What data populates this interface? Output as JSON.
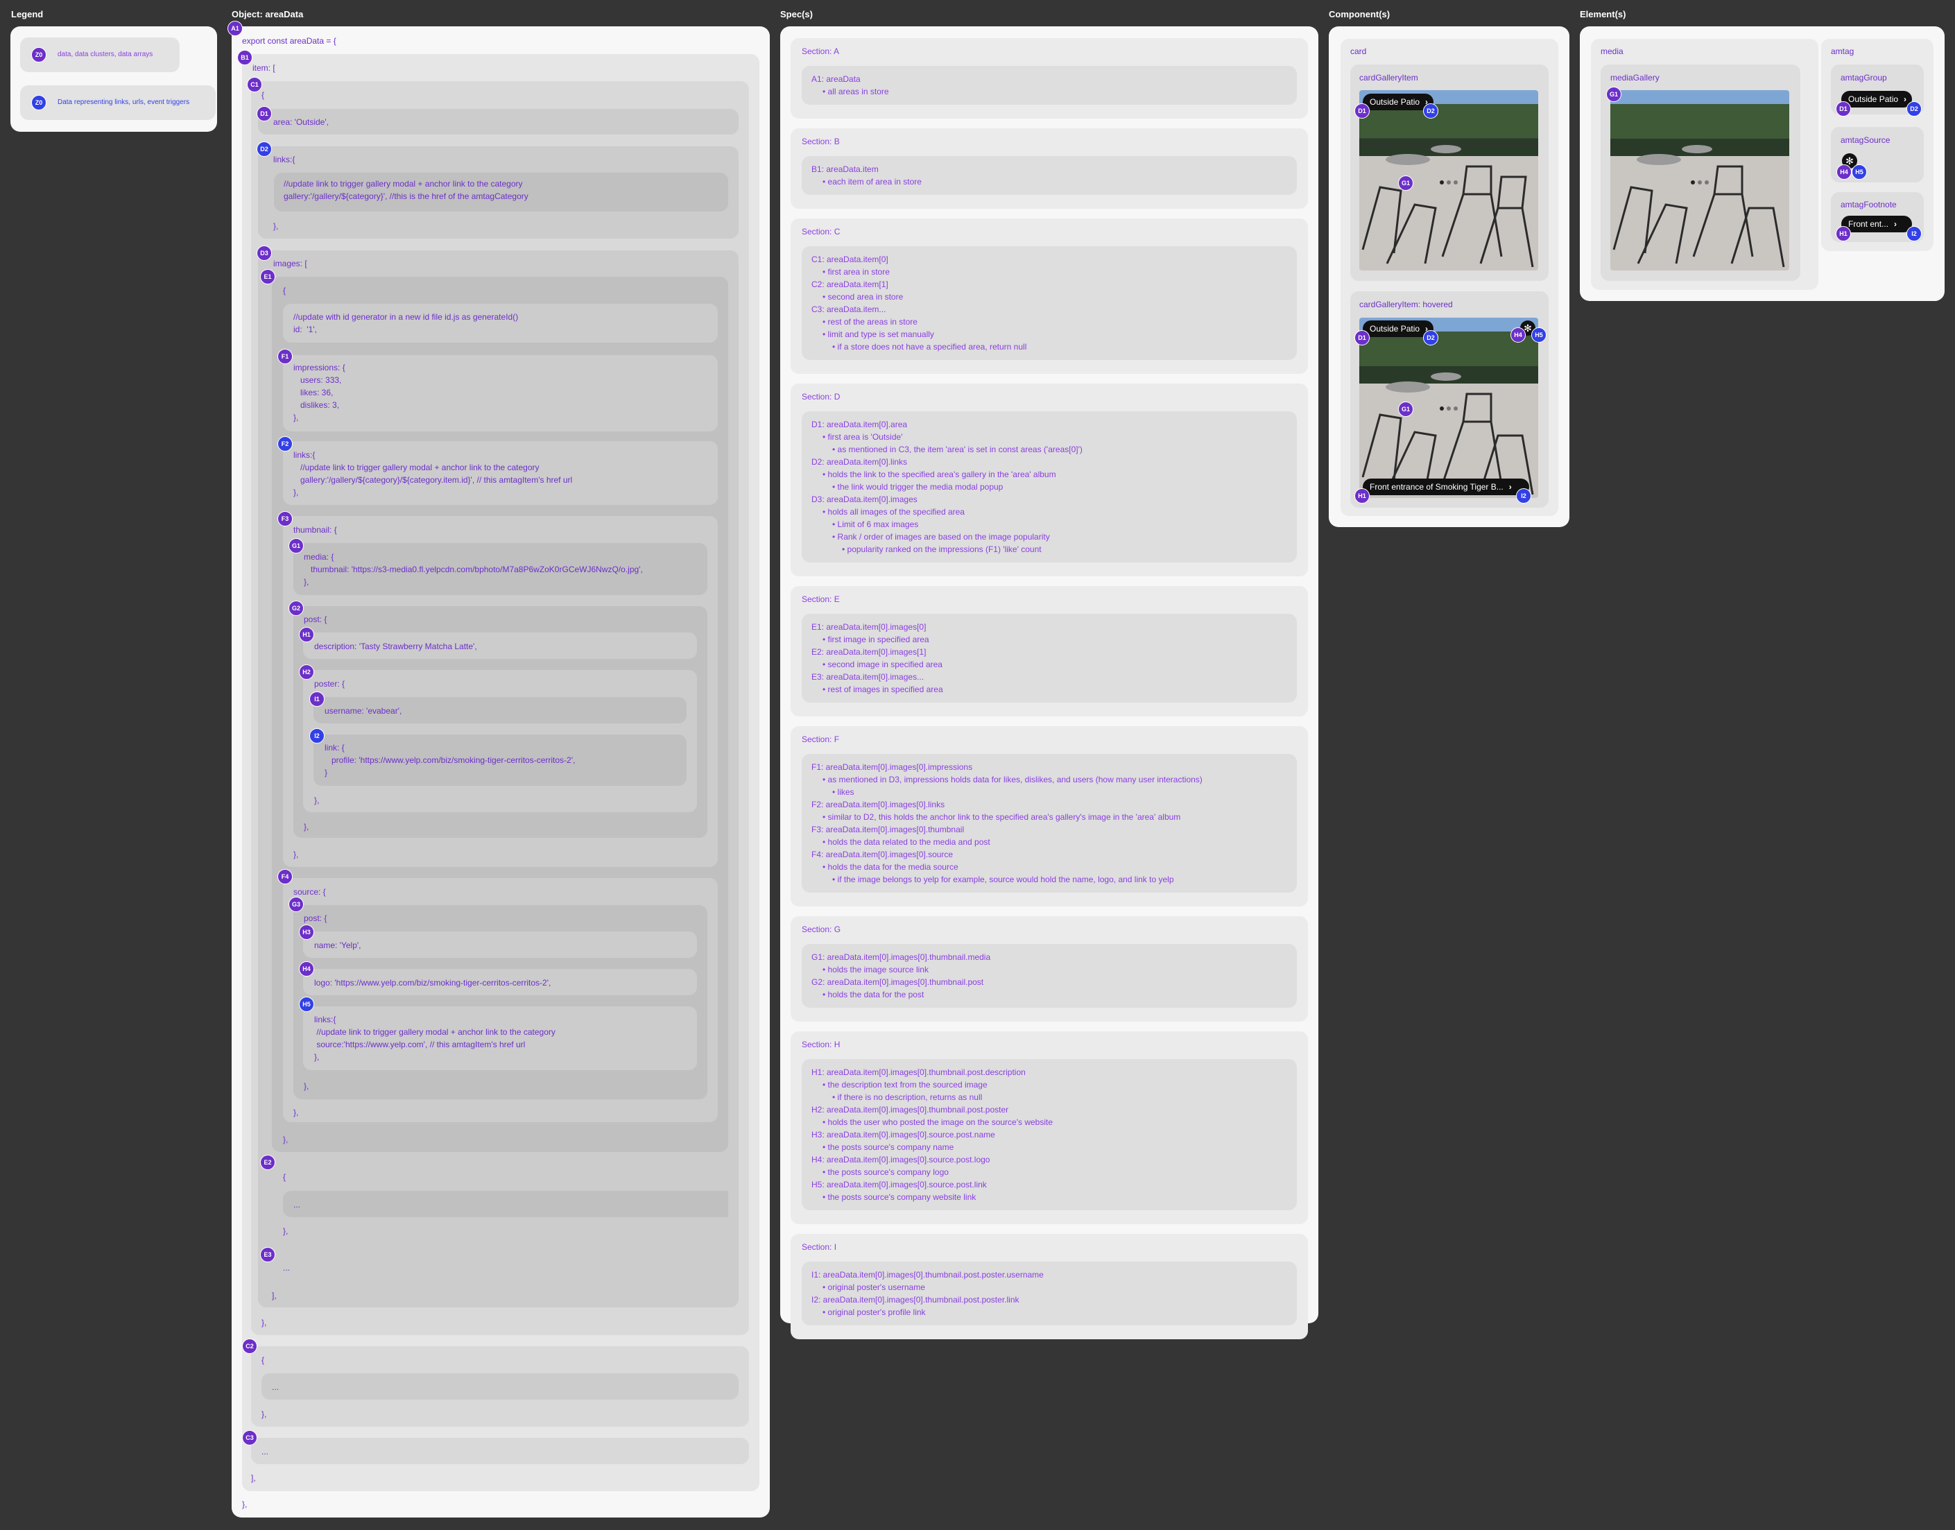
{
  "columns": {
    "legend": "Legend",
    "object": "Object: areaData",
    "specs": "Spec(s)",
    "components": "Component(s)",
    "elements": "Element(s)"
  },
  "legend": {
    "items": [
      {
        "badge": "Z0",
        "label": "data, data clusters, data arrays",
        "color": "#6c2fc9"
      },
      {
        "badge": "Z0",
        "label": "Data representing links, urls, event triggers",
        "color": "#3240e6"
      }
    ]
  },
  "object": {
    "lines": {
      "export": "export const areaData = {",
      "item_open": "item: [",
      "brace": "{",
      "area": "area: 'Outside',",
      "links_open": "links:{",
      "links_body": "//update link to trigger gallery modal + anchor link to the category\ngallery:'/gallery/${category}', //this is the href of the amtagCategory",
      "close_comma": "},",
      "images_open": "images: [",
      "id_body": "//update with id generator in a new id file id.js as generateId()\nid:  '1',",
      "impressions_body": "impressions: {\n   users: 333,\n   likes: 36,\n   dislikes: 3,\n},",
      "img_links_body": "links:{\n   //update link to trigger gallery modal + anchor link to the category\n   gallery:'/gallery/${category}/${category.item.id}', // this amtagItem's href url\n},",
      "thumbnail_open": "thumbnail: {",
      "media_body": "media: {\n   thumbnail: 'https://s3-media0.fl.yelpcdn.com/bphoto/M7a8P6wZoK0rGCeWJ6NwzQ/o.jpg',\n},",
      "post_open": "post: {",
      "description": "description: 'Tasty Strawberry Matcha Latte',",
      "poster_open": "poster: {",
      "username": "username: 'evabear',",
      "link_body": "link: {\n   profile: 'https://www.yelp.com/biz/smoking-tiger-cerritos-cerritos-2',\n}",
      "source_open": "source: {",
      "name": "name: 'Yelp',",
      "logo": "logo: 'https://www.yelp.com/biz/smoking-tiger-cerritos-cerritos-2',",
      "src_links_body": "links:{\n //update link to trigger gallery modal + anchor link to the category\n source:'https://www.yelp.com', // this amtagItem's href url\n},",
      "ellipsis": "...",
      "array_close": "],",
      "final_close": "},"
    },
    "badges": [
      "A1",
      "B1",
      "C1",
      "D1",
      "D2",
      "D3",
      "E1",
      "F1",
      "F2",
      "F3",
      "G1",
      "G2",
      "H1",
      "H2",
      "I1",
      "I2",
      "F4",
      "G3",
      "H3",
      "H4",
      "H5",
      "E2",
      "E3",
      "C2",
      "C3"
    ]
  },
  "specs": [
    {
      "title": "Section: A",
      "lines": [
        {
          "t": "A1: areaData",
          "i": 0
        },
        {
          "t": "• all areas in store",
          "i": 1
        }
      ]
    },
    {
      "title": "Section: B",
      "lines": [
        {
          "t": "B1: areaData.item",
          "i": 0
        },
        {
          "t": "• each item of area in store",
          "i": 1
        }
      ]
    },
    {
      "title": "Section: C",
      "lines": [
        {
          "t": "C1: areaData.item[0]",
          "i": 0
        },
        {
          "t": "• first area in store",
          "i": 1
        },
        {
          "t": "C2: areaData.item[1]",
          "i": 0
        },
        {
          "t": "• second area in store",
          "i": 1
        },
        {
          "t": "C3: areaData.item...",
          "i": 0
        },
        {
          "t": "• rest of the areas in store",
          "i": 1
        },
        {
          "t": "• limit and type is set manually",
          "i": 1
        },
        {
          "t": "• if a store does not have a specified area, return null",
          "i": 2
        }
      ]
    },
    {
      "title": "Section: D",
      "lines": [
        {
          "t": "D1: areaData.item[0].area",
          "i": 0
        },
        {
          "t": "• first area is 'Outside'",
          "i": 1
        },
        {
          "t": "• as mentioned in C3, the item 'area' is set in const areas ('areas[0]')",
          "i": 2
        },
        {
          "t": "D2: areaData.item[0].links",
          "i": 0
        },
        {
          "t": "• holds the link to the specified area's gallery in the 'area' album",
          "i": 1
        },
        {
          "t": "• the link would trigger the media modal popup",
          "i": 2
        },
        {
          "t": "D3: areaData.item[0].images",
          "i": 0
        },
        {
          "t": "• holds all images of the specified area",
          "i": 1
        },
        {
          "t": "• Limit of 6 max images",
          "i": 2
        },
        {
          "t": "• Rank / order of images are based on the image popularity",
          "i": 2
        },
        {
          "t": "• popularity ranked on the impressions (F1) 'like' count",
          "i": 3
        }
      ]
    },
    {
      "title": "Section: E",
      "lines": [
        {
          "t": "E1: areaData.item[0].images[0]",
          "i": 0
        },
        {
          "t": "• first image in specified area",
          "i": 1
        },
        {
          "t": "E2: areaData.item[0].images[1]",
          "i": 0
        },
        {
          "t": "• second image in specified area",
          "i": 1
        },
        {
          "t": "E3: areaData.item[0].images...",
          "i": 0
        },
        {
          "t": "• rest of images in specified area",
          "i": 1
        }
      ]
    },
    {
      "title": "Section: F",
      "lines": [
        {
          "t": "F1: areaData.item[0].images[0].impressions",
          "i": 0
        },
        {
          "t": "• as mentioned in D3, impressions holds data for likes, dislikes, and users (how many user interactions)",
          "i": 1
        },
        {
          "t": "• likes",
          "i": 2
        },
        {
          "t": "F2: areaData.item[0].images[0].links",
          "i": 0
        },
        {
          "t": "• similar to D2, this holds the anchor link to the specified area's gallery's image in the 'area' album",
          "i": 1
        },
        {
          "t": "F3: areaData.item[0].images[0].thumbnail",
          "i": 0
        },
        {
          "t": "• holds the data related to the media and post",
          "i": 1
        },
        {
          "t": "F4: areaData.item[0].images[0].source",
          "i": 0
        },
        {
          "t": "• holds the data for the media source",
          "i": 1
        },
        {
          "t": "• if the image belongs to yelp for example, source would hold the name, logo, and link to yelp",
          "i": 2
        }
      ]
    },
    {
      "title": "Section: G",
      "lines": [
        {
          "t": "G1: areaData.item[0].images[0].thumbnail.media",
          "i": 0
        },
        {
          "t": "• holds the image source link",
          "i": 1
        },
        {
          "t": "G2: areaData.item[0].images[0].thumbnail.post",
          "i": 0
        },
        {
          "t": "• holds the data for the post",
          "i": 1
        }
      ]
    },
    {
      "title": "Section: H",
      "lines": [
        {
          "t": "H1: areaData.item[0].images[0].thumbnail.post.description",
          "i": 0
        },
        {
          "t": "• the description text from the sourced image",
          "i": 1
        },
        {
          "t": "• if there is no description, returns as null",
          "i": 2
        },
        {
          "t": "H2: areaData.item[0].images[0].thumbnail.post.poster",
          "i": 0
        },
        {
          "t": "• holds the user who posted the image on the source's website",
          "i": 1
        },
        {
          "t": "H3: areaData.item[0].images[0].source.post.name",
          "i": 0
        },
        {
          "t": "• the posts source's company name",
          "i": 1
        },
        {
          "t": "H4: areaData.item[0].images[0].source.post.logo",
          "i": 0
        },
        {
          "t": "• the posts source's company logo",
          "i": 1
        },
        {
          "t": "H5: areaData.item[0].images[0].source.post.link",
          "i": 0
        },
        {
          "t": "• the posts source's company website link",
          "i": 1
        }
      ]
    },
    {
      "title": "Section: I",
      "lines": [
        {
          "t": "I1: areaData.item[0].images[0].thumbnail.post.poster.username",
          "i": 0
        },
        {
          "t": "• original poster's username",
          "i": 1
        },
        {
          "t": "I2: areaData.item[0].images[0].thumbnail.post.poster.link",
          "i": 0
        },
        {
          "t": "• original poster's profile link",
          "i": 1
        }
      ]
    }
  ],
  "components": {
    "card": "card",
    "item": "cardGalleryItem",
    "item_hovered": "cardGalleryItem: hovered",
    "area_pill": "Outside Patio",
    "footnote_pill": "Front entrance of Smoking Tiger B...",
    "badges": {
      "d1": "D1",
      "d2": "D2",
      "g1": "G1",
      "h4": "H4",
      "h5": "H5",
      "h1": "H1",
      "i2": "I2"
    }
  },
  "elements": {
    "media": "media",
    "media_gallery": "mediaGallery",
    "amtag": "amtag",
    "amtag_group": "amtagGroup",
    "amtag_source": "amtagSource",
    "amtag_footnote": "amtagFootnote",
    "group_pill": "Outside Patio",
    "footnote_pill": "Front ent...",
    "badges": {
      "g1": "G1",
      "d1": "D1",
      "d2": "D2",
      "h4": "H4",
      "h5": "H5",
      "h1": "H1",
      "i2": "I2"
    }
  }
}
